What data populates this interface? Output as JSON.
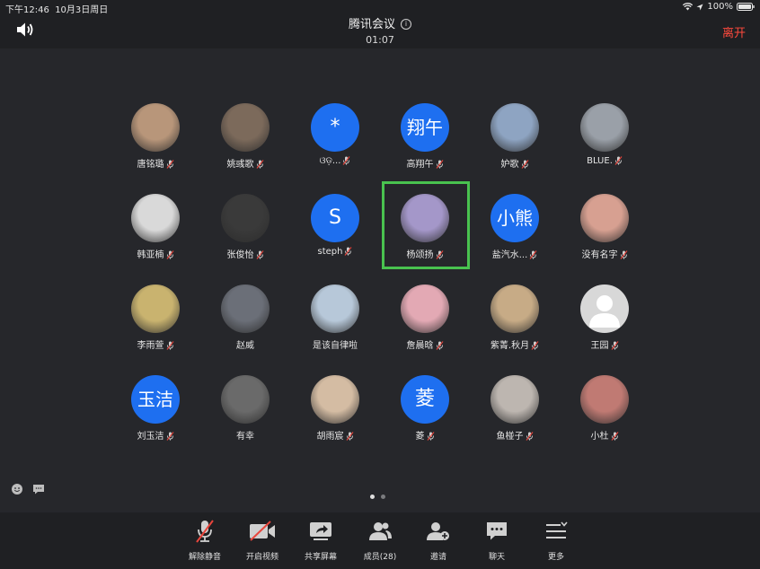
{
  "status_bar": {
    "time": "下午12:46",
    "date": "10月3日周日",
    "battery": "100%"
  },
  "header": {
    "title": "腾讯会议",
    "timer": "01:07",
    "leave_label": "离开"
  },
  "participants": [
    {
      "name": "唐铭璐",
      "avatar_type": "photo",
      "avatar_color": "#b8967a",
      "muted": true
    },
    {
      "name": "姚彧歌",
      "avatar_type": "photo",
      "avatar_color": "#7c6a5b",
      "muted": true
    },
    {
      "name": "ଓଡ଼...",
      "avatar_type": "text",
      "avatar_text": "*",
      "muted": true
    },
    {
      "name": "高翔午",
      "avatar_type": "text",
      "avatar_text": "翔午",
      "muted": true
    },
    {
      "name": "妒歌",
      "avatar_type": "photo",
      "avatar_color": "#8ea4c2",
      "muted": true
    },
    {
      "name": "BLUE.",
      "avatar_type": "photo",
      "avatar_color": "#9aa0a8",
      "muted": true
    },
    {
      "name": "韩亚楠",
      "avatar_type": "photo",
      "avatar_color": "#d9d9d9",
      "muted": true
    },
    {
      "name": "张俊怡",
      "avatar_type": "photo",
      "avatar_color": "#3a3a3a",
      "muted": true
    },
    {
      "name": "steph",
      "avatar_type": "text",
      "avatar_text": "S",
      "muted": true
    },
    {
      "name": "杨颂扬",
      "avatar_type": "photo",
      "avatar_color": "#a497c9",
      "muted": true,
      "active_speaker": true
    },
    {
      "name": "盐汽水...",
      "avatar_type": "text",
      "avatar_text": "小熊",
      "muted": true
    },
    {
      "name": "没有名字",
      "avatar_type": "photo",
      "avatar_color": "#d7a091",
      "muted": true
    },
    {
      "name": "李雨萱",
      "avatar_type": "photo",
      "avatar_color": "#c9b36f",
      "muted": true
    },
    {
      "name": "赵威",
      "avatar_type": "photo",
      "avatar_color": "#6b6f78",
      "muted": false
    },
    {
      "name": "是该自律啦",
      "avatar_type": "photo",
      "avatar_color": "#b7c8d9",
      "muted": false
    },
    {
      "name": "詹晨晗",
      "avatar_type": "photo",
      "avatar_color": "#e3a9b4",
      "muted": true
    },
    {
      "name": "紫菁.秋月",
      "avatar_type": "photo",
      "avatar_color": "#c7ab86",
      "muted": true
    },
    {
      "name": "王园",
      "avatar_type": "default",
      "avatar_color": "#d8d8d8",
      "muted": true
    },
    {
      "name": "刘玉洁",
      "avatar_type": "text",
      "avatar_text": "玉洁",
      "muted": true
    },
    {
      "name": "有幸",
      "avatar_type": "photo",
      "avatar_color": "#6a6a6a",
      "muted": false
    },
    {
      "name": "胡雨宸",
      "avatar_type": "photo",
      "avatar_color": "#d4bca3",
      "muted": true
    },
    {
      "name": "菱",
      "avatar_type": "text",
      "avatar_text": "菱",
      "muted": true
    },
    {
      "name": "鱼椪子",
      "avatar_type": "photo",
      "avatar_color": "#bdb6b0",
      "muted": true
    },
    {
      "name": "小杜",
      "avatar_type": "photo",
      "avatar_color": "#c07a73",
      "muted": true
    }
  ],
  "toolbar": {
    "unmute_label": "解除静音",
    "video_label": "开启视频",
    "share_label": "共享屏幕",
    "members_label": "成员(28)",
    "invite_label": "邀请",
    "chat_label": "聊天",
    "more_label": "更多"
  },
  "colors": {
    "accent_blue": "#1e6ff0",
    "leave_red": "#ff4a3d",
    "active_green": "#49c24f"
  },
  "page_indicator": {
    "pages": 2,
    "current": 1
  }
}
